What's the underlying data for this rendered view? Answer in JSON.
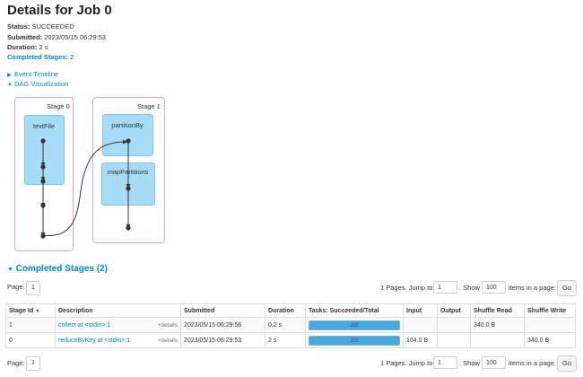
{
  "page": {
    "title": "Details for Job 0"
  },
  "job_info": {
    "status_label": "Status:",
    "status_value": "SUCCEEDED",
    "submitted_label": "Submitted:",
    "submitted_value": "2023/05/15 06:29:53",
    "duration_label": "Duration:",
    "duration_value": "2 s",
    "completed_stages_label": "Completed Stages:",
    "completed_stages_value": "2"
  },
  "toggles": {
    "event_timeline": "Event Timeline",
    "dag_visualization": "DAG Visualization"
  },
  "dag": {
    "stages": [
      {
        "label": "Stage 0",
        "rdds": [
          "textFile"
        ]
      },
      {
        "label": "Stage 1",
        "rdds": [
          "partitionBy",
          "mapPartitions"
        ]
      }
    ]
  },
  "completed_stages": {
    "title": "Completed Stages (2)",
    "pager": {
      "page_label": "Page:",
      "current_page": "1",
      "pages_text": "1 Pages. Jump to",
      "jump_value": "1",
      "show_label": ". Show",
      "show_value": "100",
      "items_text": "items in a page.",
      "go_label": "Go"
    },
    "columns": [
      "Stage Id",
      "Description",
      "Submitted",
      "Duration",
      "Tasks: Succeeded/Total",
      "Input",
      "Output",
      "Shuffle Read",
      "Shuffle Write"
    ],
    "sort_indicator": "▼",
    "rows": [
      {
        "stage_id": "1",
        "description": "collect at <stdin>:1",
        "details": "+details",
        "submitted": "2023/05/15 06:29:56",
        "duration": "0.2 s",
        "tasks": "2/2",
        "tasks_fraction": 1.0,
        "input": "",
        "output": "",
        "shuffle_read": "340.0 B",
        "shuffle_write": ""
      },
      {
        "stage_id": "0",
        "description": "reduceByKey at <stdin>:1",
        "details": "+details",
        "submitted": "2023/05/15 06:29:53",
        "duration": "2 s",
        "tasks": "2/2",
        "tasks_fraction": 1.0,
        "input": "104.0 B",
        "output": "",
        "shuffle_read": "",
        "shuffle_write": "340.0 B"
      }
    ]
  },
  "colors": {
    "link": "#0088cc",
    "rdd_fill": "#a6dcf5",
    "stage_border": "#e6a8b6",
    "progress": "#4aa8dc"
  }
}
